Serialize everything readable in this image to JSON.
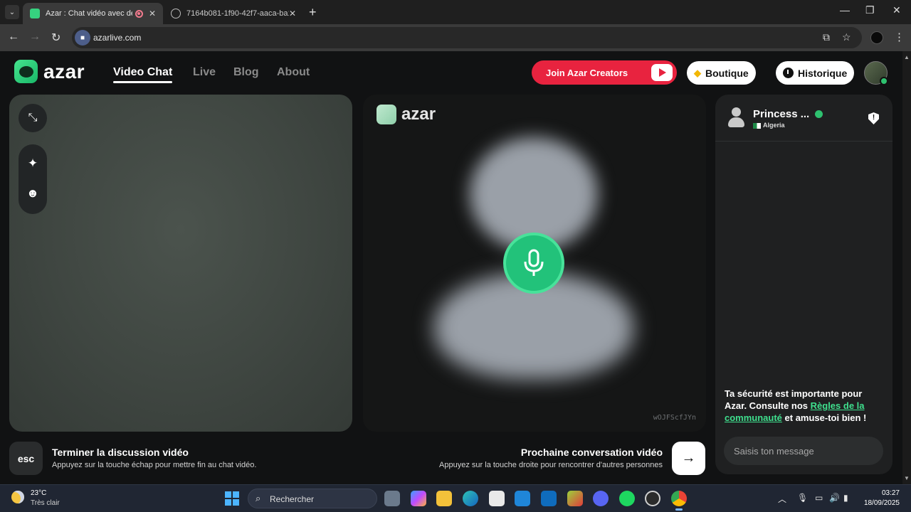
{
  "browser": {
    "tabs": [
      {
        "title": "Azar : Chat vidéo avec de n",
        "active": true
      },
      {
        "title": "7164b081-1f90-42f7-aaca-ba1",
        "active": false
      }
    ],
    "url": "azarlive.com"
  },
  "header": {
    "logo_text": "azar",
    "nav": [
      "Video Chat",
      "Live",
      "Blog",
      "About"
    ],
    "creators_label": "Join Azar Creators",
    "boutique_label": "Boutique",
    "historique_label": "Historique"
  },
  "center_video": {
    "logo_text": "azar",
    "code": "wOJFScfJYn"
  },
  "bottom": {
    "esc_key": "esc",
    "end_title": "Terminer la discussion vidéo",
    "end_sub": "Appuyez sur la touche échap pour mettre fin au chat vidéo.",
    "next_title": "Prochaine conversation vidéo",
    "next_sub": "Appuyez sur la touche droite pour rencontrer d'autres personnes"
  },
  "chat": {
    "partner_name": "Princess ...",
    "partner_country": "Algeria",
    "safety_prefix": "Ta sécurité est importante pour Azar. Consulte nos ",
    "safety_link": "Règles de la communauté",
    "safety_suffix": " et amuse-toi bien !",
    "input_placeholder": "Saisis ton message"
  },
  "taskbar": {
    "temperature": "23°C",
    "weather": "Très clair",
    "search_label": "Rechercher",
    "time": "03:27",
    "date": "18/09/2025"
  },
  "colors": {
    "accent_green": "#22c27a",
    "creators_red": "#e8233f",
    "link_green": "#3fe08e"
  }
}
